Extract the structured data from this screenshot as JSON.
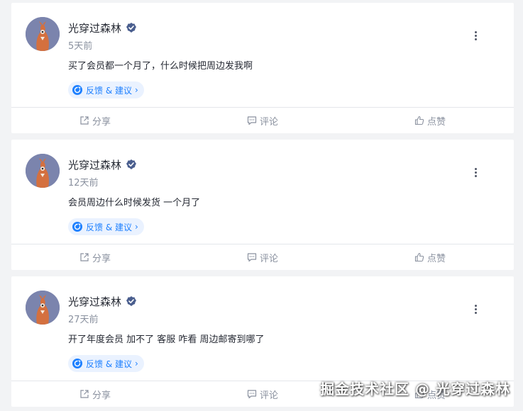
{
  "posts": [
    {
      "author": "光穿过森林",
      "time": "5天前",
      "content": "买了会员都一个月了，什么时候把周边发我啊",
      "tag": "反馈 & 建议",
      "actions": {
        "share": "分享",
        "comment": "评论",
        "like": "点赞"
      }
    },
    {
      "author": "光穿过森林",
      "time": "12天前",
      "content": "会员周边什么时候发货 一个月了",
      "tag": "反馈 & 建议",
      "actions": {
        "share": "分享",
        "comment": "评论",
        "like": "点赞"
      }
    },
    {
      "author": "光穿过森林",
      "time": "27天前",
      "content": "开了年度会员 加不了 客服 咋看 周边邮寄到哪了",
      "tag": "反馈 & 建议",
      "actions": {
        "share": "分享",
        "comment": "评论",
        "like": "点赞"
      }
    }
  ],
  "icons": {
    "verified": "verified-badge-icon",
    "tag": "feedback-tag-icon",
    "more": "more-dots-icon",
    "share": "share-icon",
    "comment": "comment-icon",
    "like": "thumbs-up-icon"
  },
  "colors": {
    "accent": "#1e80ff",
    "tag_background": "#eaf2ff",
    "page_background": "#f2f3f5",
    "muted_text": "#8a919f",
    "avatar_background": "#7b84ad",
    "avatar_figure": "#d4703f"
  },
  "watermark": "掘金技术社区 @ 光穿过森林"
}
